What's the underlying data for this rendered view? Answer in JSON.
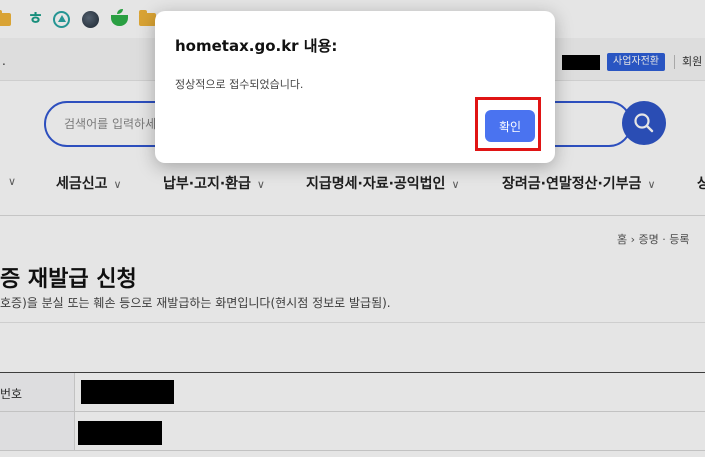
{
  "dialog": {
    "title": "hometax.go.kr 내용:",
    "message": "정상적으로 접수되었습니다.",
    "ok_label": "확인"
  },
  "utility_bar": {
    "truncated_text": ".",
    "biz_switch_label": "사업자전환",
    "member_label": "회원"
  },
  "search": {
    "placeholder": "검색어를 입력하세"
  },
  "nav": {
    "items": [
      {
        "label": "세금신고"
      },
      {
        "label": "납부·고지·환급"
      },
      {
        "label": "지급명세·자료·공익법인"
      },
      {
        "label": "장려금·연말정산·기부금"
      },
      {
        "label": "상"
      }
    ]
  },
  "breadcrumb": "홈 › 증명 · 등록",
  "page": {
    "title": "증 재발급 신청",
    "description": "호증)을 분실 또는 훼손 등으로 재발급하는 화면입니다(현시점 정보로 발급됨)."
  },
  "form": {
    "row1_label": "번호"
  },
  "colors": {
    "primary_blue": "#2f56c9",
    "ok_button": "#4a73f0",
    "highlight_red": "#e01414"
  },
  "icons": [
    "folder-icon",
    "hana-bank-icon",
    "hometax-icon",
    "globe-icon",
    "cup-icon",
    "search-icon"
  ]
}
